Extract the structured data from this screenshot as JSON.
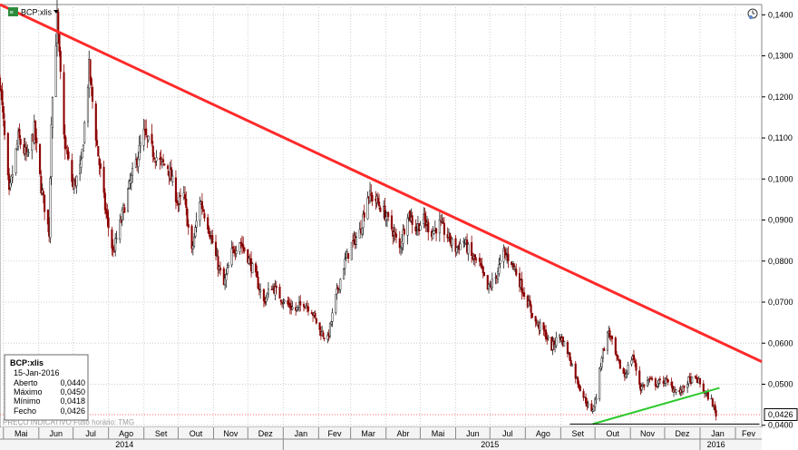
{
  "symbol": "BCP:xlis",
  "footer": "PREÇO INDICATIVO   Fuso horário: TMG",
  "icons": [
    "exchange-badge-icon",
    "dropdown-arrow-icon",
    "clock-icon"
  ],
  "info_box": {
    "title": "BCP:xlis",
    "date": "15-Jan-2016",
    "rows": [
      {
        "label": "Aberto",
        "value": "0,0440"
      },
      {
        "label": "Máximo",
        "value": "0,0450"
      },
      {
        "label": "Mínimo",
        "value": "0,0418"
      },
      {
        "label": "Fecho",
        "value": "0,0426"
      }
    ]
  },
  "last_price": "0,0426",
  "colors": {
    "up": "#1a1a1a",
    "down": "#8b0000",
    "resistance": "#ff2a2a",
    "support": "#2ec92e",
    "floor": "#000000",
    "price_line": "#ff6666",
    "grid": "#cfcfcf"
  },
  "chart_data": {
    "type": "candlestick",
    "title": "BCP:xlis",
    "y_ticks": [
      "0,1400",
      "0,1300",
      "0,1200",
      "0,1100",
      "0,1000",
      "0,0900",
      "0,0800",
      "0,0700",
      "0,0600",
      "0,0500",
      "0,0400"
    ],
    "x_months": [
      {
        "label": "Mai",
        "date": "2014-05"
      },
      {
        "label": "Jun",
        "date": "2014-06"
      },
      {
        "label": "Jul",
        "date": "2014-07"
      },
      {
        "label": "Ago",
        "date": "2014-08"
      },
      {
        "label": "Set",
        "date": "2014-09"
      },
      {
        "label": "Out",
        "date": "2014-10"
      },
      {
        "label": "Nov",
        "date": "2014-11"
      },
      {
        "label": "Dez",
        "date": "2014-12"
      },
      {
        "label": "Jan",
        "date": "2015-01"
      },
      {
        "label": "Fev",
        "date": "2015-02"
      },
      {
        "label": "Mar",
        "date": "2015-03"
      },
      {
        "label": "Abr",
        "date": "2015-04"
      },
      {
        "label": "Mai",
        "date": "2015-05"
      },
      {
        "label": "Jun",
        "date": "2015-06"
      },
      {
        "label": "Jul",
        "date": "2015-07"
      },
      {
        "label": "Ago",
        "date": "2015-08"
      },
      {
        "label": "Set",
        "date": "2015-09"
      },
      {
        "label": "Out",
        "date": "2015-10"
      },
      {
        "label": "Nov",
        "date": "2015-11"
      },
      {
        "label": "Dez",
        "date": "2015-12"
      },
      {
        "label": "Jan",
        "date": "2016-01"
      },
      {
        "label": "Fev",
        "date": "2016-02"
      }
    ],
    "years": [
      {
        "label": "2014",
        "date": "2014-08-15"
      },
      {
        "label": "2015",
        "date": "2015-07-01"
      },
      {
        "label": "2016",
        "date": "2016-01-15"
      }
    ],
    "ylim": [
      0.0395,
      0.1425
    ],
    "xlim": [
      "2014-04-28",
      "2016-02-24"
    ],
    "close_path": [
      [
        "2014-04-28",
        0.124
      ],
      [
        "2014-05-06",
        0.096
      ],
      [
        "2014-05-14",
        0.11
      ],
      [
        "2014-05-22",
        0.105
      ],
      [
        "2014-05-28",
        0.112
      ],
      [
        "2014-06-03",
        0.098
      ],
      [
        "2014-06-10",
        0.087
      ],
      [
        "2014-06-12",
        0.115
      ],
      [
        "2014-06-17",
        0.139
      ],
      [
        "2014-06-23",
        0.11
      ],
      [
        "2014-07-01",
        0.098
      ],
      [
        "2014-07-08",
        0.103
      ],
      [
        "2014-07-15",
        0.127
      ],
      [
        "2014-07-22",
        0.108
      ],
      [
        "2014-07-29",
        0.093
      ],
      [
        "2014-08-05",
        0.082
      ],
      [
        "2014-08-12",
        0.09
      ],
      [
        "2014-08-19",
        0.098
      ],
      [
        "2014-09-01",
        0.111
      ],
      [
        "2014-09-08",
        0.107
      ],
      [
        "2014-09-15",
        0.104
      ],
      [
        "2014-09-22",
        0.103
      ],
      [
        "2014-10-01",
        0.094
      ],
      [
        "2014-10-06",
        0.096
      ],
      [
        "2014-10-13",
        0.082
      ],
      [
        "2014-10-20",
        0.095
      ],
      [
        "2014-10-27",
        0.089
      ],
      [
        "2014-11-03",
        0.081
      ],
      [
        "2014-11-10",
        0.074
      ],
      [
        "2014-11-17",
        0.082
      ],
      [
        "2014-11-24",
        0.085
      ],
      [
        "2014-12-01",
        0.081
      ],
      [
        "2014-12-08",
        0.076
      ],
      [
        "2014-12-15",
        0.07
      ],
      [
        "2014-12-22",
        0.074
      ],
      [
        "2015-01-02",
        0.07
      ],
      [
        "2015-01-12",
        0.068
      ],
      [
        "2015-01-19",
        0.07
      ],
      [
        "2015-01-26",
        0.068
      ],
      [
        "2015-02-02",
        0.063
      ],
      [
        "2015-02-09",
        0.061
      ],
      [
        "2015-02-16",
        0.071
      ],
      [
        "2015-02-23",
        0.079
      ],
      [
        "2015-03-02",
        0.084
      ],
      [
        "2015-03-09",
        0.087
      ],
      [
        "2015-03-16",
        0.096
      ],
      [
        "2015-03-23",
        0.095
      ],
      [
        "2015-03-30",
        0.092
      ],
      [
        "2015-04-06",
        0.088
      ],
      [
        "2015-04-13",
        0.083
      ],
      [
        "2015-04-20",
        0.092
      ],
      [
        "2015-04-27",
        0.088
      ],
      [
        "2015-05-04",
        0.09
      ],
      [
        "2015-05-11",
        0.087
      ],
      [
        "2015-05-18",
        0.089
      ],
      [
        "2015-05-25",
        0.086
      ],
      [
        "2015-06-01",
        0.083
      ],
      [
        "2015-06-08",
        0.085
      ],
      [
        "2015-06-15",
        0.081
      ],
      [
        "2015-06-22",
        0.079
      ],
      [
        "2015-06-29",
        0.073
      ],
      [
        "2015-07-06",
        0.076
      ],
      [
        "2015-07-13",
        0.082
      ],
      [
        "2015-07-20",
        0.08
      ],
      [
        "2015-07-27",
        0.075
      ],
      [
        "2015-08-03",
        0.07
      ],
      [
        "2015-08-10",
        0.065
      ],
      [
        "2015-08-17",
        0.063
      ],
      [
        "2015-08-24",
        0.059
      ],
      [
        "2015-08-31",
        0.062
      ],
      [
        "2015-09-07",
        0.058
      ],
      [
        "2015-09-14",
        0.052
      ],
      [
        "2015-09-21",
        0.047
      ],
      [
        "2015-09-28",
        0.043
      ],
      [
        "2015-10-02",
        0.047
      ],
      [
        "2015-10-07",
        0.057
      ],
      [
        "2015-10-13",
        0.063
      ],
      [
        "2015-10-20",
        0.056
      ],
      [
        "2015-10-27",
        0.052
      ],
      [
        "2015-11-03",
        0.057
      ],
      [
        "2015-11-10",
        0.049
      ],
      [
        "2015-11-17",
        0.051
      ],
      [
        "2015-11-24",
        0.05
      ],
      [
        "2015-12-01",
        0.051
      ],
      [
        "2015-12-08",
        0.049
      ],
      [
        "2015-12-15",
        0.048
      ],
      [
        "2015-12-22",
        0.051
      ],
      [
        "2015-12-30",
        0.051
      ],
      [
        "2016-01-05",
        0.048
      ],
      [
        "2016-01-11",
        0.046
      ],
      [
        "2016-01-15",
        0.0426
      ]
    ],
    "trend_lines": [
      {
        "name": "resistance",
        "from": [
          "2014-04-28",
          0.1425
        ],
        "to": [
          "2016-02-24",
          0.0555
        ]
      },
      {
        "name": "support",
        "from": [
          "2015-09-29",
          0.0403
        ],
        "to": [
          "2016-01-18",
          0.0491
        ]
      },
      {
        "name": "floor",
        "from": [
          "2015-09-09",
          0.0403
        ],
        "to": [
          "2016-02-22",
          0.0403
        ]
      }
    ],
    "last_value": 0.0426
  }
}
